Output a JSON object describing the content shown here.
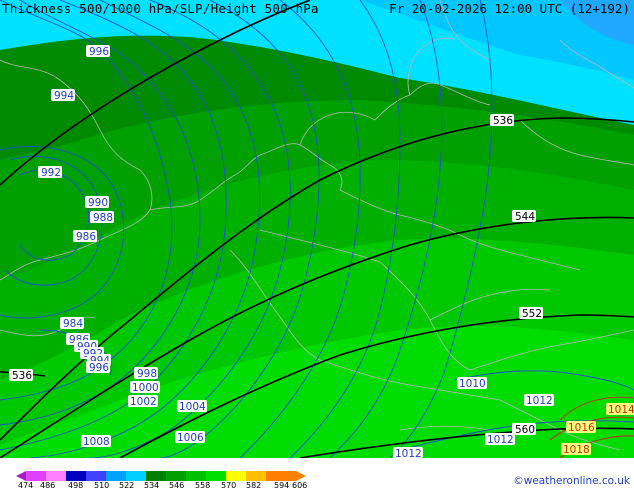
{
  "footer": {
    "title": "Thickness 500/1000 hPa/SLP/Height 500 hPa",
    "valid": "Fr 20-02-2026 12:00 UTC (12+192)",
    "copyright": "©weatheronline.co.uk"
  },
  "legend": {
    "ticks": [
      "474",
      "486",
      "498",
      "510",
      "522",
      "534",
      "546",
      "558",
      "570",
      "582",
      "594",
      "606"
    ],
    "colors": [
      "#a020c0",
      "#e040ff",
      "#ff80ff",
      "#0000c0",
      "#4040ff",
      "#00a0ff",
      "#00d0ff",
      "#008000",
      "#00a000",
      "#00c000",
      "#00e000",
      "#ffff00",
      "#ffc000",
      "#ff8000"
    ]
  },
  "isobars": [
    "996",
    "994",
    "992",
    "990",
    "988",
    "986",
    "984",
    "986",
    "990",
    "992",
    "994",
    "996",
    "998",
    "1000",
    "1002",
    "1004",
    "1006",
    "1008",
    "1010",
    "1012",
    "1012",
    "1012",
    "1014",
    "1016",
    "1018"
  ],
  "thickness_labels": [
    "536",
    "544",
    "552",
    "560",
    "536"
  ],
  "colors": {
    "cyan": "#00e0ff",
    "light_blue": "#00c0ff",
    "green_dark": "#008a00",
    "green_mid": "#00a000",
    "green_bright": "#00c800",
    "green_light": "#00dc00",
    "isobar": "#2050d0",
    "coast": "#b0b0b0",
    "high_isobar": "#d02020"
  }
}
